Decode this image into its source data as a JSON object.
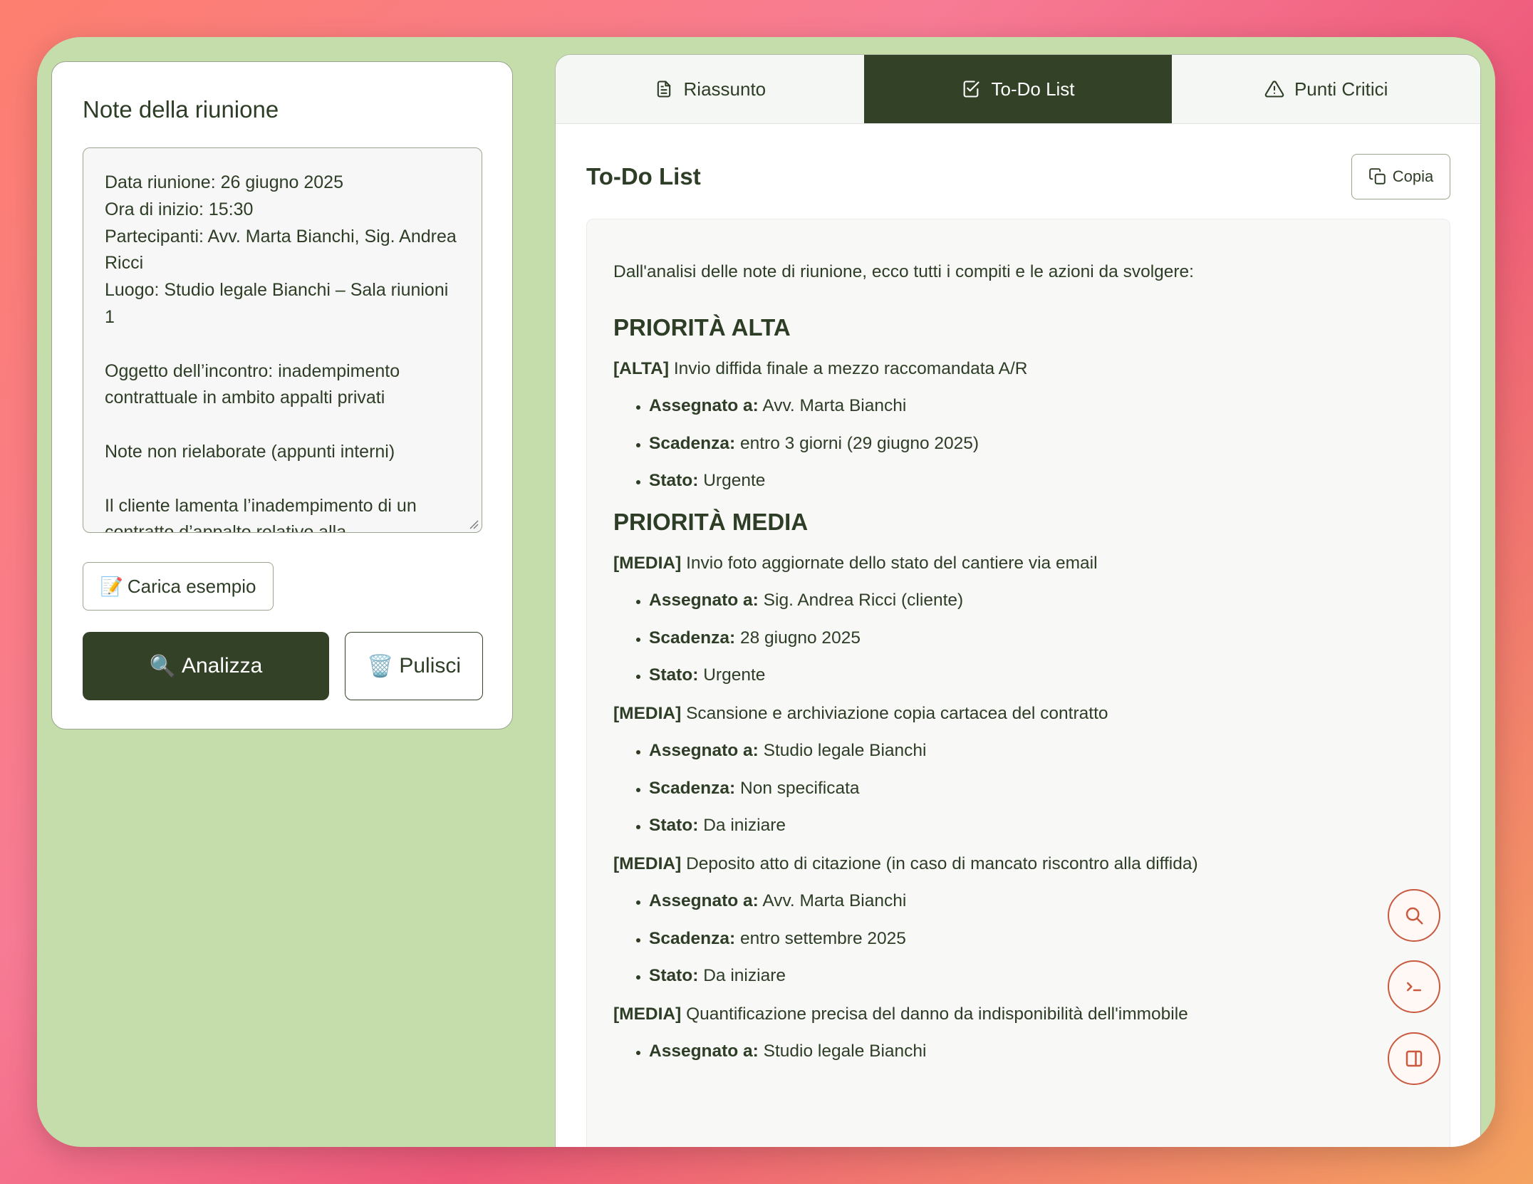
{
  "left": {
    "title": "Note della riunione",
    "notes_lines": [
      "Data riunione: 26 giugno 2025",
      "Ora di inizio: 15:30",
      "Partecipanti: Avv. Marta Bianchi, Sig. Andrea Ricci",
      "Luogo: Studio legale Bianchi – Sala riunioni 1",
      "",
      "Oggetto dell’incontro: inadempimento contrattuale in ambito appalti privati",
      "",
      "Note non rielaborate (appunti interni)",
      "",
      "Il cliente lamenta l’inadempimento di un contratto d’appalto relativo alla"
    ],
    "example_button": "Carica esempio",
    "example_emoji": "📝",
    "analyze_button": "Analizza",
    "analyze_emoji": "🔍",
    "clear_button": "Pulisci",
    "clear_emoji": "🗑️"
  },
  "tabs": [
    {
      "label": "Riassunto",
      "icon": "document-icon",
      "active": false
    },
    {
      "label": "To-Do List",
      "icon": "checkbox-icon",
      "active": true
    },
    {
      "label": "Punti Critici",
      "icon": "warning-icon",
      "active": false
    }
  ],
  "panel": {
    "title": "To-Do List",
    "copy_button": "Copia",
    "intro": "Dall'analisi delle note di riunione, ecco tutti i compiti e le azioni da svolgere:",
    "labels": {
      "assigned": "Assegnato a:",
      "due": "Scadenza:",
      "status": "Stato:"
    },
    "sections": [
      {
        "heading": "PRIORITÀ ALTA",
        "tasks": [
          {
            "tag": "[ALTA]",
            "title": "Invio diffida finale a mezzo raccomandata A/R",
            "assigned": "Avv. Marta Bianchi",
            "due": "entro 3 giorni (29 giugno 2025)",
            "status": "Urgente"
          }
        ]
      },
      {
        "heading": "PRIORITÀ MEDIA",
        "tasks": [
          {
            "tag": "[MEDIA]",
            "title": "Invio foto aggiornate dello stato del cantiere via email",
            "assigned": "Sig. Andrea Ricci (cliente)",
            "due": "28 giugno 2025",
            "status": "Urgente"
          },
          {
            "tag": "[MEDIA]",
            "title": "Scansione e archiviazione copia cartacea del contratto",
            "assigned": "Studio legale Bianchi",
            "due": "Non specificata",
            "status": "Da iniziare"
          },
          {
            "tag": "[MEDIA]",
            "title": "Deposito atto di citazione (in caso di mancato riscontro alla diffida)",
            "assigned": "Avv. Marta Bianchi",
            "due": "entro settembre 2025",
            "status": "Da iniziare"
          },
          {
            "tag": "[MEDIA]",
            "title": "Quantificazione precisa del danno da indisponibilità dell'immobile",
            "assigned": "Studio legale Bianchi",
            "due": null,
            "status": null
          }
        ]
      }
    ]
  },
  "fabs": [
    {
      "icon": "search-icon"
    },
    {
      "icon": "terminal-icon"
    },
    {
      "icon": "sidebar-panel-icon"
    }
  ],
  "colors": {
    "accent": "#334227",
    "frame": "#c5ddaa",
    "fab_border": "#c9593f"
  }
}
